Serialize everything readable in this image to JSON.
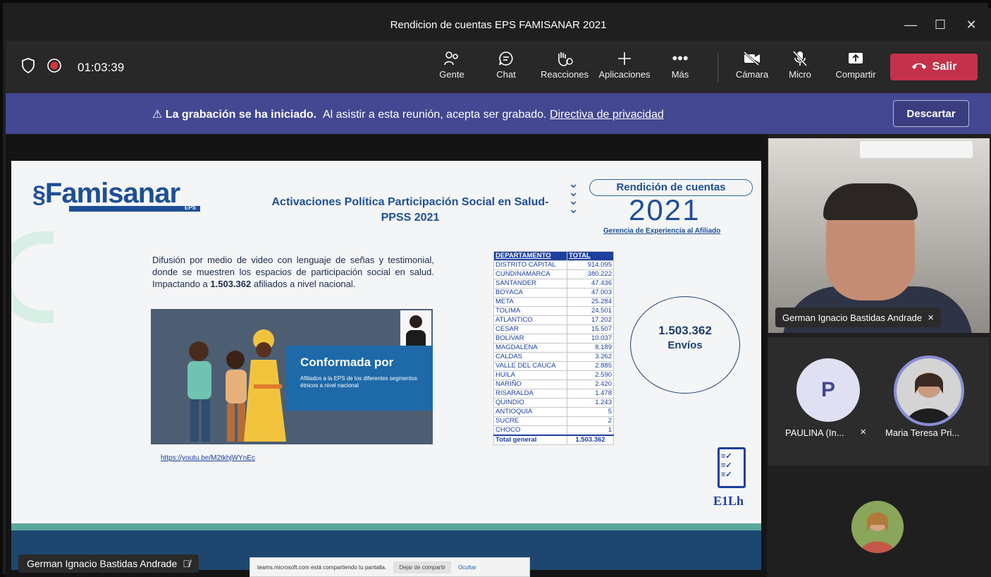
{
  "window": {
    "title": "Rendicion de cuentas EPS FAMISANAR 2021",
    "minimize": "—",
    "maximize": "☐",
    "close": "✕"
  },
  "toolbar": {
    "timer": "01:03:39",
    "items": [
      {
        "label": "Gente",
        "icon": "people-icon"
      },
      {
        "label": "Chat",
        "icon": "chat-icon"
      },
      {
        "label": "Reacciones",
        "icon": "reactions-icon"
      },
      {
        "label": "Aplicaciones",
        "icon": "apps-icon"
      },
      {
        "label": "Más",
        "icon": "more-icon"
      },
      {
        "label": "Cámara",
        "icon": "camera-off-icon"
      },
      {
        "label": "Micro",
        "icon": "mic-off-icon"
      },
      {
        "label": "Compartir",
        "icon": "share-icon"
      }
    ],
    "leave_label": "Salir"
  },
  "banner": {
    "bold": "La grabación se ha iniciado.",
    "text": "Al asistir a esta reunión, acepta ser grabado.",
    "link": "Directiva de privacidad",
    "dismiss": "Descartar"
  },
  "slide": {
    "logo": "Famisanar",
    "logo_sub": "EPS",
    "title": "Activaciones Política Participación Social en Salud-PPSS 2021",
    "badge": "Rendición de cuentas",
    "year": "2021",
    "subtitle": "Gerencia de Experiencia al Afiliado",
    "paragraph_pre": "Difusión por medio de video con lenguaje de señas y testimonial, donde se muestren los espacios de participación social en salud. Impactando a ",
    "paragraph_bold": "1.503.362",
    "paragraph_post": " afiliados a nivel nacional.",
    "video_heading": "Conformada por",
    "video_sub": "Afiliados a la EPS de los diferentes segmentos étnicos a nivel nacional",
    "link": "https://youtu.be/M2tkhjWYnEc",
    "table_headers": [
      "DEPARTAMENTO",
      "TOTAL"
    ],
    "table_rows": [
      [
        "DISTRITO CAPITAL",
        "914.095"
      ],
      [
        "CUNDINAMARCA",
        "380.222"
      ],
      [
        "SANTANDER",
        "47.436"
      ],
      [
        "BOYACA",
        "47.003"
      ],
      [
        "META",
        "25.284"
      ],
      [
        "TOLIMA",
        "24.501"
      ],
      [
        "ATLANTICO",
        "17.202"
      ],
      [
        "CESAR",
        "15.507"
      ],
      [
        "BOLIVAR",
        "10.037"
      ],
      [
        "MAGDALENA",
        "8.189"
      ],
      [
        "CALDAS",
        "3.262"
      ],
      [
        "VALLE DEL CAUCA",
        "2.885"
      ],
      [
        "HUILA",
        "2.590"
      ],
      [
        "NARIÑO",
        "2.420"
      ],
      [
        "RISARALDA",
        "1.478"
      ],
      [
        "QUINDIO",
        "1.243"
      ],
      [
        "ANTIOQUIA",
        "5"
      ],
      [
        "SUCRE",
        "2"
      ],
      [
        "CHOCO",
        "1"
      ]
    ],
    "table_total": [
      "Total general",
      "1.503.362"
    ],
    "ellipse_value": "1.503.362",
    "ellipse_label": "Envíos",
    "corner_label": "E1Lh"
  },
  "stage": {
    "speaker": "German Ignacio Bastidas Andrade",
    "share_msg": "teams.microsoft.com está compartiendo tu pantalla.",
    "share_stop": "Dejar de compartir",
    "share_hide": "Ocultar"
  },
  "participants": {
    "main": "German Ignacio Bastidas Andrade",
    "p1_initial": "P",
    "p1_name": "PAULINA (In...",
    "p2_name": "Maria Teresa Pri..."
  },
  "colors": {
    "accent": "#444791",
    "leave": "#c4314b",
    "brand": "#1d4f96"
  }
}
